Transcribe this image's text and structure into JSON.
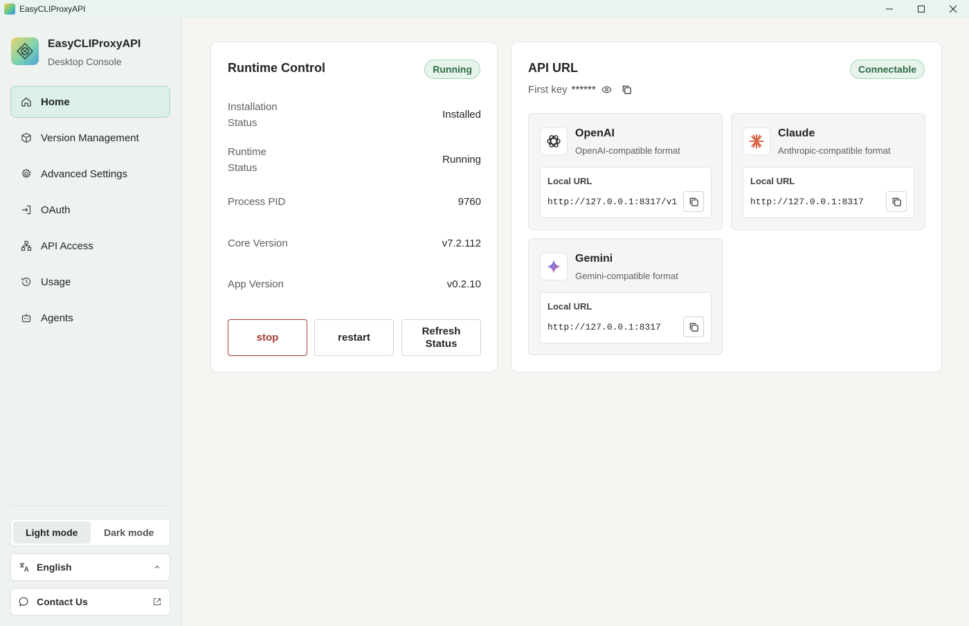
{
  "window": {
    "title": "EasyCLIProxyAPI"
  },
  "brand": {
    "name": "EasyCLIProxyAPI",
    "subtitle": "Desktop Console"
  },
  "nav": {
    "items": [
      {
        "label": "Home",
        "icon": "home-icon",
        "active": true
      },
      {
        "label": "Version Management",
        "icon": "cube-icon"
      },
      {
        "label": "Advanced Settings",
        "icon": "gear-icon"
      },
      {
        "label": "OAuth",
        "icon": "login-icon"
      },
      {
        "label": "API Access",
        "icon": "network-icon"
      },
      {
        "label": "Usage",
        "icon": "history-icon"
      },
      {
        "label": "Agents",
        "icon": "robot-icon"
      }
    ]
  },
  "theme": {
    "light_label": "Light mode",
    "dark_label": "Dark mode",
    "selected": "light"
  },
  "language": {
    "selected": "English"
  },
  "contact": {
    "label": "Contact Us"
  },
  "runtime": {
    "title": "Runtime Control",
    "badge": "Running",
    "rows": [
      {
        "label": "Installation\nStatus",
        "value": "Installed"
      },
      {
        "label": "Runtime\nStatus",
        "value": "Running"
      },
      {
        "label": "Process PID",
        "value": "9760"
      },
      {
        "label": "Core Version",
        "value": "v7.2.112"
      },
      {
        "label": "App Version",
        "value": "v0.2.10"
      }
    ],
    "buttons": {
      "stop": "stop",
      "restart": "restart",
      "refresh": "Refresh Status"
    }
  },
  "api": {
    "title": "API URL",
    "badge": "Connectable",
    "first_key_label": "First key",
    "first_key_mask": "******",
    "providers": [
      {
        "name": "OpenAI",
        "desc": "OpenAI-compatible format",
        "url_label": "Local URL",
        "url": "http://127.0.0.1:8317/v1",
        "icon": "openai-icon"
      },
      {
        "name": "Claude",
        "desc": "Anthropic-compatible format",
        "url_label": "Local URL",
        "url": "http://127.0.0.1:8317",
        "icon": "claude-icon"
      },
      {
        "name": "Gemini",
        "desc": "Gemini-compatible format",
        "url_label": "Local URL",
        "url": "http://127.0.0.1:8317",
        "icon": "gemini-icon"
      }
    ]
  },
  "colors": {
    "accent": "#2f6b47",
    "stop": "#a33a32",
    "active_nav_bg": "#dcefe8"
  }
}
